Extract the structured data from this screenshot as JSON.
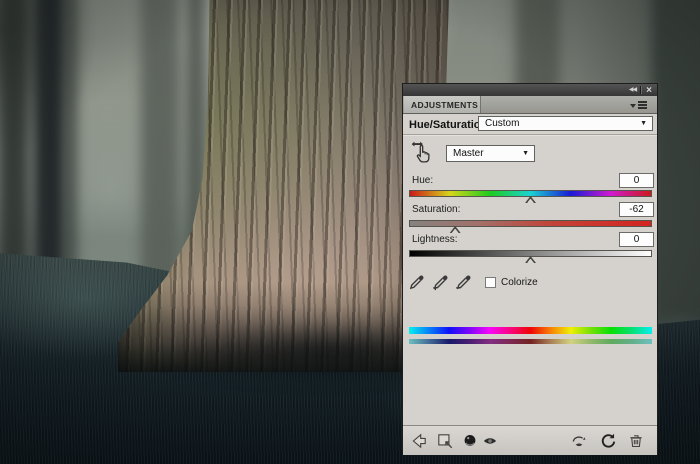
{
  "icons": {
    "collapse": "◀◀",
    "close": "×",
    "dropdown_arrow": "▼"
  },
  "panel": {
    "tab_label": "ADJUSTMENTS",
    "title": "Hue/Saturation",
    "preset_value": "Custom",
    "channel_value": "Master",
    "sliders": [
      {
        "label": "Hue:",
        "value": "0",
        "position_pct": 50
      },
      {
        "label": "Saturation:",
        "value": "-62",
        "position_pct": 19
      },
      {
        "label": "Lightness:",
        "value": "0",
        "position_pct": 50
      }
    ],
    "colorize_label": "Colorize",
    "colorize_checked": false,
    "eyedropper_icons": [
      "eyedropper-sample",
      "eyedropper-add",
      "eyedropper-subtract"
    ],
    "toolbar_icons": [
      "return-to-adjustment-list",
      "clip-to-layer",
      "adjustment-ball",
      "toggle-visibility",
      "view-previous-state",
      "reset-adjustment",
      "delete-adjustment"
    ],
    "colors": {
      "panel_bg": "#d5d2cd",
      "titlebar_bg": "#3a3a3a",
      "tab_bg": "#c2c2be",
      "saturation_red": "#d42420"
    }
  }
}
